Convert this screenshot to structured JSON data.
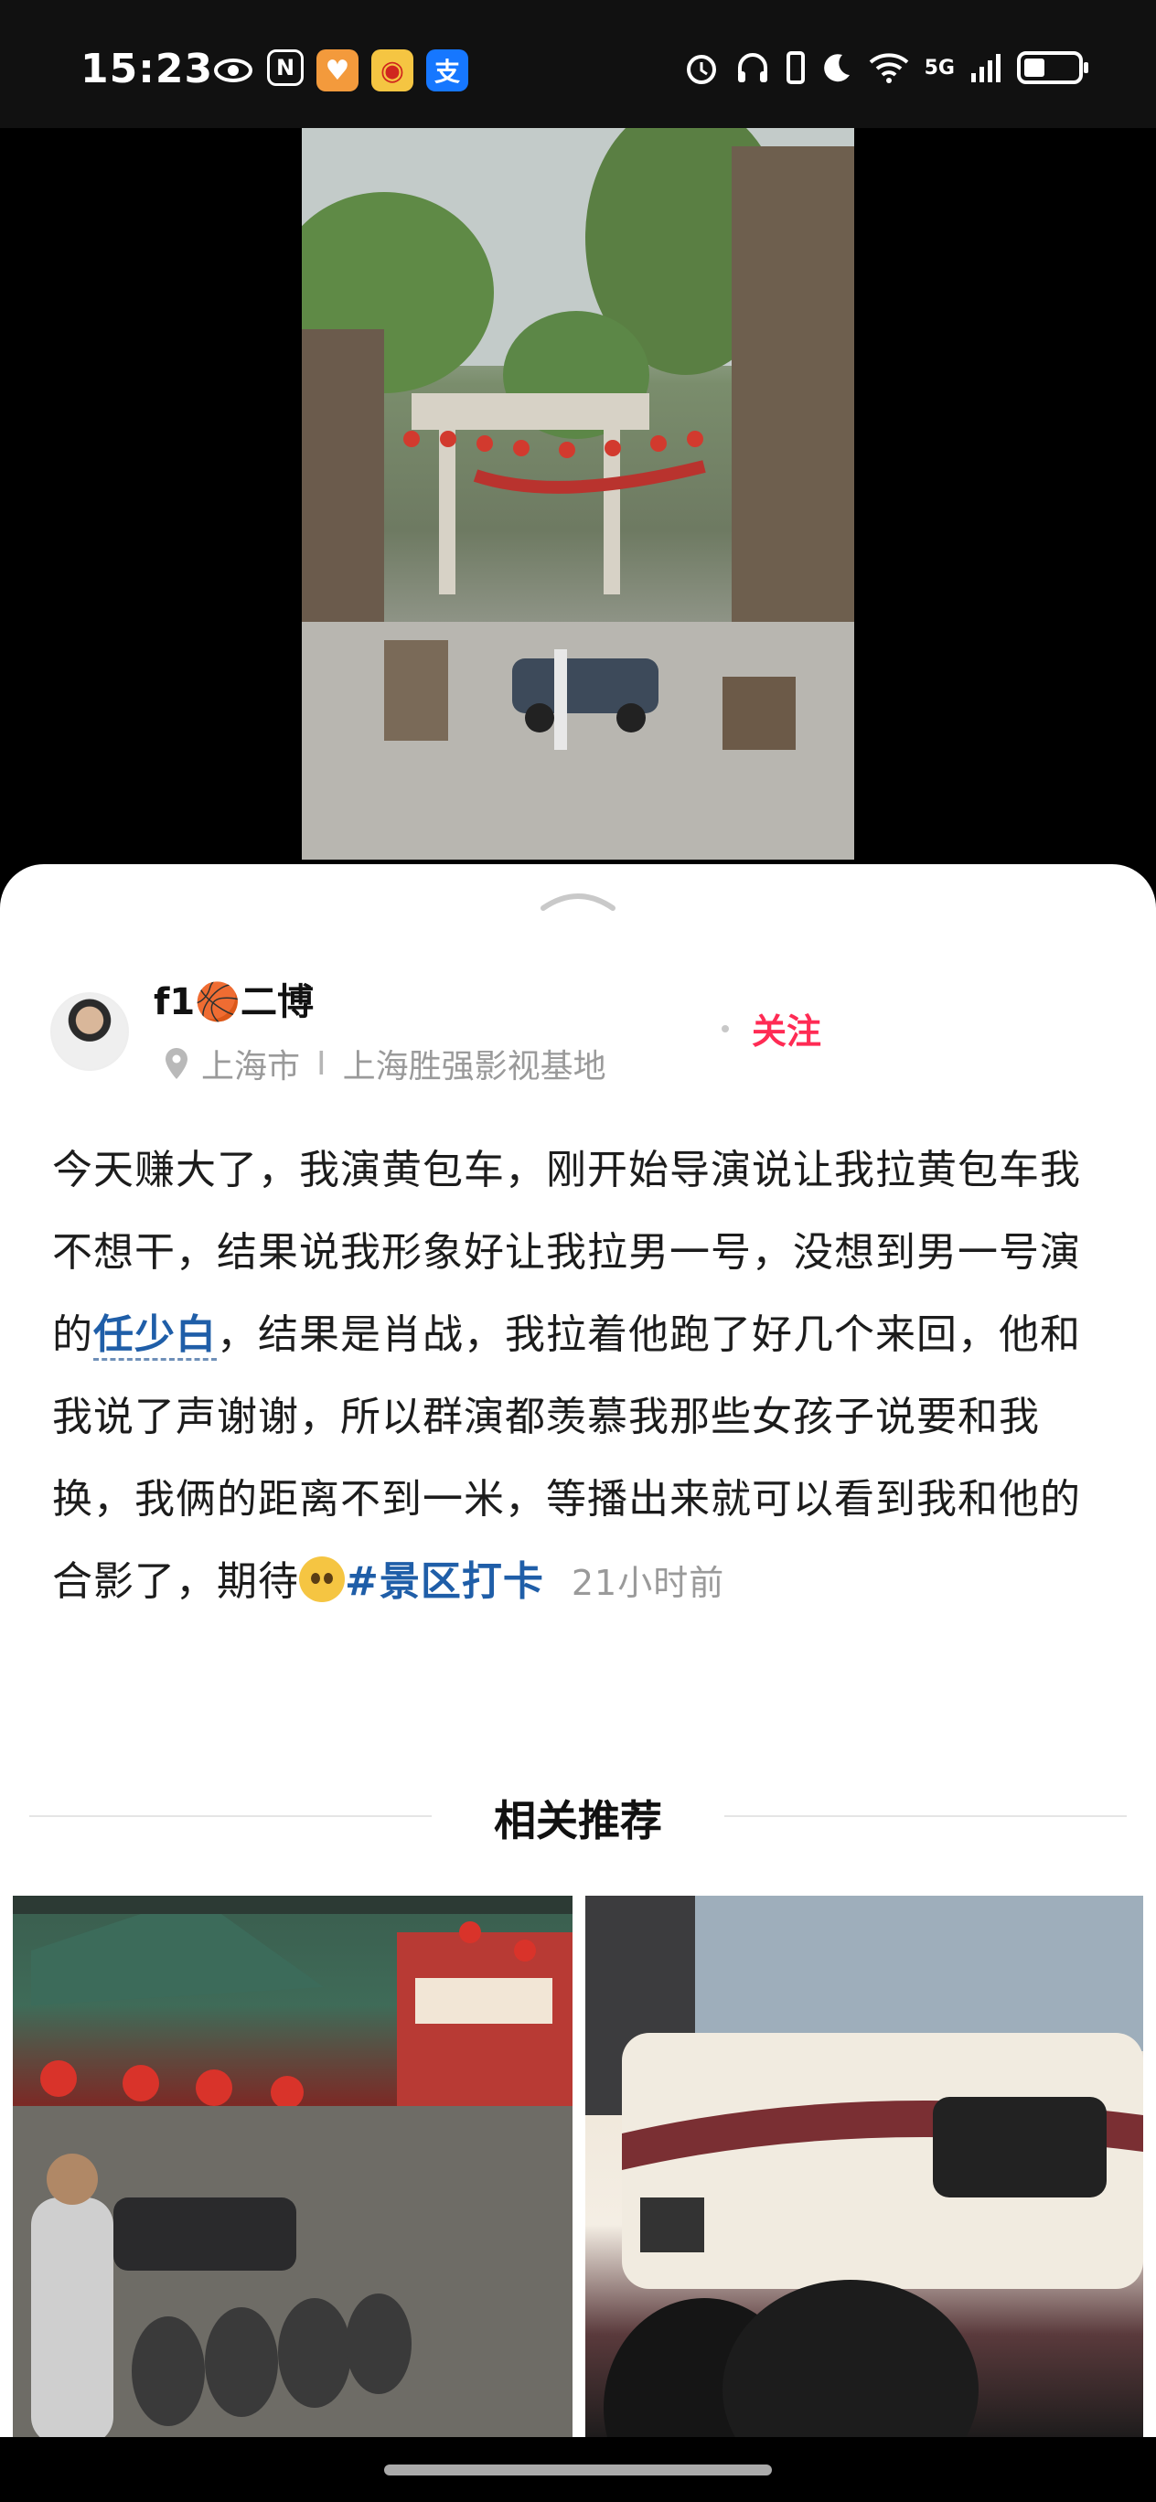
{
  "status_bar": {
    "time": "15:23",
    "network": "5G",
    "battery_level": 0.4,
    "left_icons": [
      "eye-icon",
      "nfc-icon",
      "app-heart-icon",
      "weibo-icon",
      "alipay-icon"
    ],
    "right_icons": [
      "alarm-icon",
      "headphones-icon",
      "vibrate-icon",
      "moon-icon",
      "wifi-icon",
      "signal-icon",
      "battery-icon"
    ]
  },
  "post": {
    "author_name": "f1🏀二博",
    "location_city": "上海市",
    "location_separator": "I",
    "location_place": "上海胜强影视基地",
    "follow_label": "关注",
    "text_before_mention": "今天赚大了，我演黄包车，刚开始导演说让我拉黄包车我不想干，结果说我形象好让我拉男一号，没想到男一号演的",
    "mention": "任少白",
    "text_after_mention": "，结果是肖战，我拉着他跑了好几个来回，他和我说了声谢谢，所以群演都羡慕我那些女孩子说要和我换，我俩的距离不到一米，等播出来就可以看到我和他的合影了，期待",
    "emoji": "pleading-face",
    "hashtag": "#景区打卡",
    "time_ago": "21小时前"
  },
  "recommendations": {
    "title": "相关推荐"
  },
  "colors": {
    "follow": "#ff2b54",
    "link": "#1f5ea8",
    "muted": "#9a9a9a"
  }
}
